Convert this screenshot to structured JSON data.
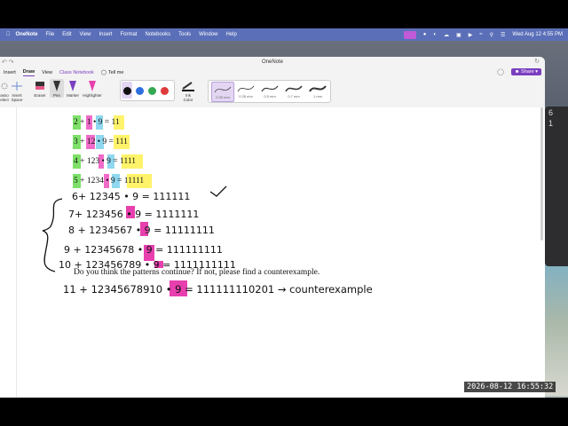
{
  "menubar": {
    "app": "OneNote",
    "items": [
      "File",
      "Edit",
      "View",
      "Insert",
      "Format",
      "Notebooks",
      "Tools",
      "Window",
      "Help"
    ],
    "datetime": "Wed Aug 12  4:55 PM"
  },
  "window": {
    "title": "OneNote",
    "tabs": [
      "Insert",
      "Draw",
      "View",
      "Class Notebook",
      "Tell me"
    ],
    "active_tab": "Draw",
    "share_label": "Share"
  },
  "ribbon": {
    "lasso_label": "asso\nelect",
    "insert_space_label": "Insert\nSpace",
    "eraser_label": "Eraser",
    "pen_label": "Pen",
    "marker_label": "Marker",
    "highlighter_label": "Highlighter",
    "ink_color_label": "Ink\nColor",
    "pen_colors": [
      "#111111",
      "#2f6fe0",
      "#34a853",
      "#e03b3b"
    ],
    "thickness_labels": [
      "0.35 mm",
      "0.35 mm",
      "0.5 mm",
      "0.7 mm",
      "1 mm"
    ]
  },
  "page": {
    "typed_lines": [
      {
        "parts": [
          "2 + ",
          "1",
          " • 9 = 11"
        ]
      },
      {
        "parts": [
          "3 + ",
          "12",
          " • 9 = 111"
        ]
      },
      {
        "parts": [
          "4 + 12",
          "3",
          " • 9 = 1111"
        ]
      },
      {
        "parts": [
          "5 + 123",
          "4",
          " • 9 = 11111"
        ]
      }
    ],
    "question": "Do you think the patterns continue?  If not, please find a counterexample.",
    "ink_lines": [
      "6+ 12345 • 9 = 111111",
      "7+ 123456 • 9 = 1111111",
      "8 + 1234567 • 9 = 11111111",
      "9 + 12345678 • 9 = 111111111",
      "10 + 123456789 • 9 = 1111111111",
      "11 + 12345678910 • 9 = 111111110201 → counterexample"
    ]
  },
  "highlight_colors": {
    "green": "#7ee06a",
    "pink": "#f06bc8",
    "blue": "#8fd8ef",
    "yellow": "#fff36b",
    "magenta": "#e83fae"
  },
  "timestamp": "2026-08-12  16:55:32"
}
